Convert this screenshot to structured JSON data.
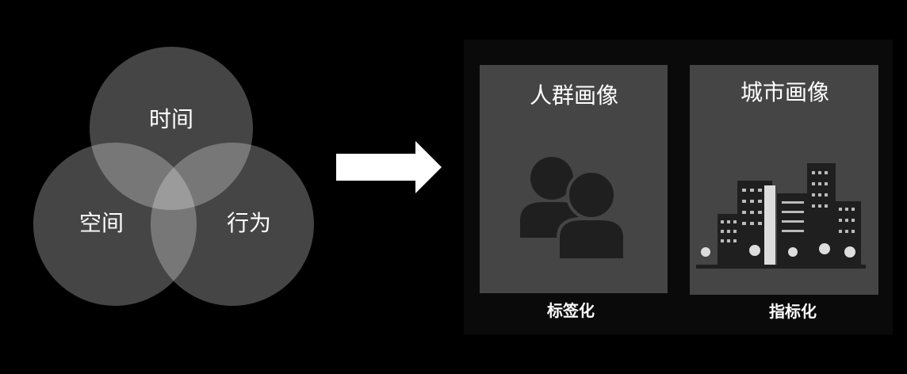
{
  "venn": {
    "circles": [
      {
        "label": "时间"
      },
      {
        "label": "空间"
      },
      {
        "label": "行为"
      }
    ]
  },
  "cards": [
    {
      "title": "人群画像",
      "caption": "标签化",
      "icon": "people-icon"
    },
    {
      "title": "城市画像",
      "caption": "指标化",
      "icon": "city-buildings-icon"
    }
  ],
  "colors": {
    "background": "#000000",
    "panel": "#0a0a0a",
    "card": "#454545",
    "icon": "#1f1f1f"
  }
}
